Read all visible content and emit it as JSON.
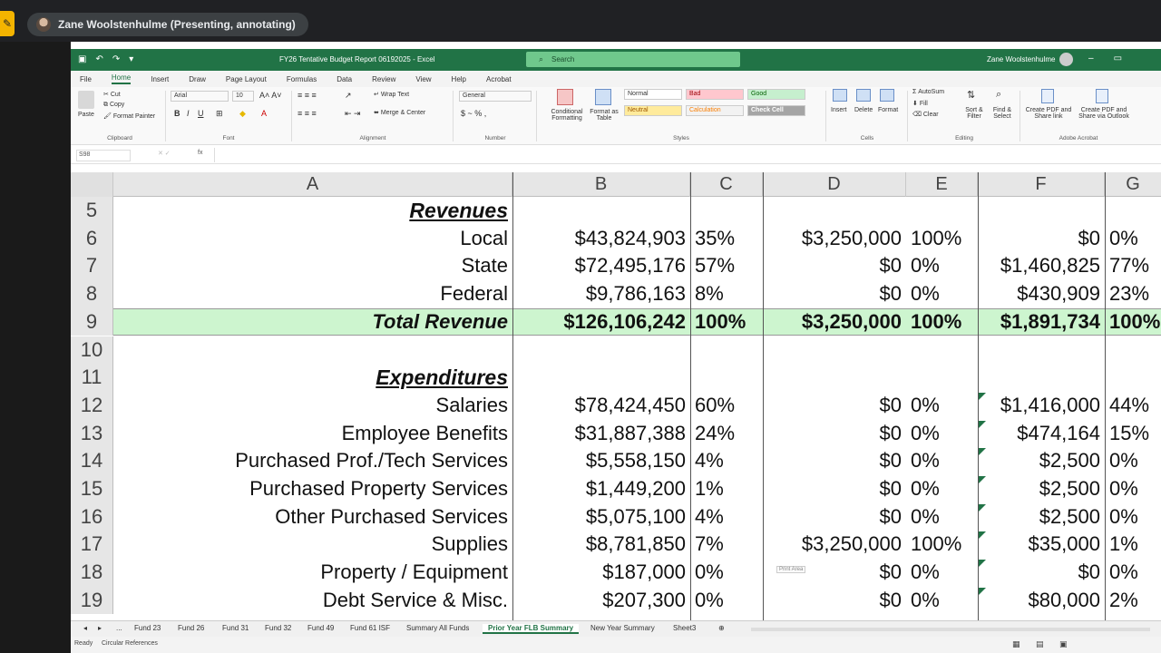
{
  "meet": {
    "presenter": "Zane Woolstenhulme (Presenting, annotating)"
  },
  "excel": {
    "doc_title": "FY26 Tentative Budget Report 06192025  -  Excel",
    "search_placeholder": "Search",
    "user_name": "Zane Woolstenhulme",
    "menu": [
      "File",
      "Home",
      "Insert",
      "Draw",
      "Page Layout",
      "Formulas",
      "Data",
      "Review",
      "View",
      "Help",
      "Acrobat"
    ],
    "ribbon": {
      "clipboard": {
        "paste": "Paste",
        "cut": "Cut",
        "copy": "Copy",
        "format_painter": "Format Painter",
        "label": "Clipboard"
      },
      "font": {
        "name": "Arial",
        "size": "10",
        "label": "Font"
      },
      "alignment": {
        "wrap": "Wrap Text",
        "merge": "Merge & Center",
        "label": "Alignment"
      },
      "number": {
        "format": "General",
        "label": "Number"
      },
      "styles": {
        "conditional": "Conditional Formatting",
        "format_table": "Format as Table",
        "normal": "Normal",
        "bad": "Bad",
        "good": "Good",
        "neutral": "Neutral",
        "calculation": "Calculation",
        "check_cell": "Check Cell",
        "label": "Styles"
      },
      "cells": {
        "insert": "Insert",
        "delete": "Delete",
        "format": "Format",
        "label": "Cells"
      },
      "editing": {
        "autosum": "AutoSum",
        "fill": "Fill",
        "clear": "Clear",
        "sort": "Sort & Filter",
        "find": "Find & Select",
        "label": "Editing"
      },
      "acrobat": {
        "create_pdf": "Create PDF and Share link",
        "create_outlook": "Create PDF and Share via Outlook",
        "label": "Adobe Acrobat"
      }
    },
    "namebox": "S98",
    "fx": "fx",
    "columns": [
      "A",
      "B",
      "C",
      "D",
      "E",
      "F",
      "G"
    ],
    "rows": [
      {
        "n": "5",
        "a": "Revenues",
        "b": "",
        "c": "",
        "d": "",
        "e": "",
        "f": "",
        "g": ""
      },
      {
        "n": "6",
        "a": "Local",
        "b": "$43,824,903",
        "c": "35%",
        "d": "$3,250,000",
        "e": "100%",
        "f": "$0",
        "g": "0%"
      },
      {
        "n": "7",
        "a": "State",
        "b": "$72,495,176",
        "c": "57%",
        "d": "$0",
        "e": "0%",
        "f": "$1,460,825",
        "g": "77%"
      },
      {
        "n": "8",
        "a": "Federal",
        "b": "$9,786,163",
        "c": "8%",
        "d": "$0",
        "e": "0%",
        "f": "$430,909",
        "g": "23%"
      },
      {
        "n": "9",
        "a": "Total Revenue",
        "b": "$126,106,242",
        "c": "100%",
        "d": "$3,250,000",
        "e": "100%",
        "f": "$1,891,734",
        "g": "100%"
      },
      {
        "n": "10",
        "a": "",
        "b": "",
        "c": "",
        "d": "",
        "e": "",
        "f": "",
        "g": ""
      },
      {
        "n": "11",
        "a": "Expenditures",
        "b": "",
        "c": "",
        "d": "",
        "e": "",
        "f": "",
        "g": ""
      },
      {
        "n": "12",
        "a": "Salaries",
        "b": "$78,424,450",
        "c": "60%",
        "d": "$0",
        "e": "0%",
        "f": "$1,416,000",
        "g": "44%"
      },
      {
        "n": "13",
        "a": "Employee Benefits",
        "b": "$31,887,388",
        "c": "24%",
        "d": "$0",
        "e": "0%",
        "f": "$474,164",
        "g": "15%"
      },
      {
        "n": "14",
        "a": "Purchased Prof./Tech Services",
        "b": "$5,558,150",
        "c": "4%",
        "d": "$0",
        "e": "0%",
        "f": "$2,500",
        "g": "0%"
      },
      {
        "n": "15",
        "a": "Purchased Property Services",
        "b": "$1,449,200",
        "c": "1%",
        "d": "$0",
        "e": "0%",
        "f": "$2,500",
        "g": "0%"
      },
      {
        "n": "16",
        "a": "Other Purchased Services",
        "b": "$5,075,100",
        "c": "4%",
        "d": "$0",
        "e": "0%",
        "f": "$2,500",
        "g": "0%"
      },
      {
        "n": "17",
        "a": "Supplies",
        "b": "$8,781,850",
        "c": "7%",
        "d": "$3,250,000",
        "e": "100%",
        "f": "$35,000",
        "g": "1%"
      },
      {
        "n": "18",
        "a": "Property / Equipment",
        "b": "$187,000",
        "c": "0%",
        "d": "$0",
        "e": "0%",
        "f": "$0",
        "g": "0%"
      },
      {
        "n": "19",
        "a": "Debt Service & Misc.",
        "b": "$207,300",
        "c": "0%",
        "d": "$0",
        "e": "0%",
        "f": "$80,000",
        "g": "2%"
      }
    ],
    "print_area": "Print Area",
    "sheet_tabs": [
      "Fund 23",
      "Fund 26",
      "Fund 31",
      "Fund 32",
      "Fund 49",
      "Fund 61 ISF",
      "Summary All Funds",
      "Prior Year FLB Summary",
      "New Year Summary",
      "Sheet3"
    ],
    "active_tab": "Prior Year FLB Summary",
    "status": {
      "ready": "Ready",
      "circular": "Circular References"
    },
    "colors": {
      "brand": "#217346",
      "total_row": "#cdf5cf"
    }
  }
}
